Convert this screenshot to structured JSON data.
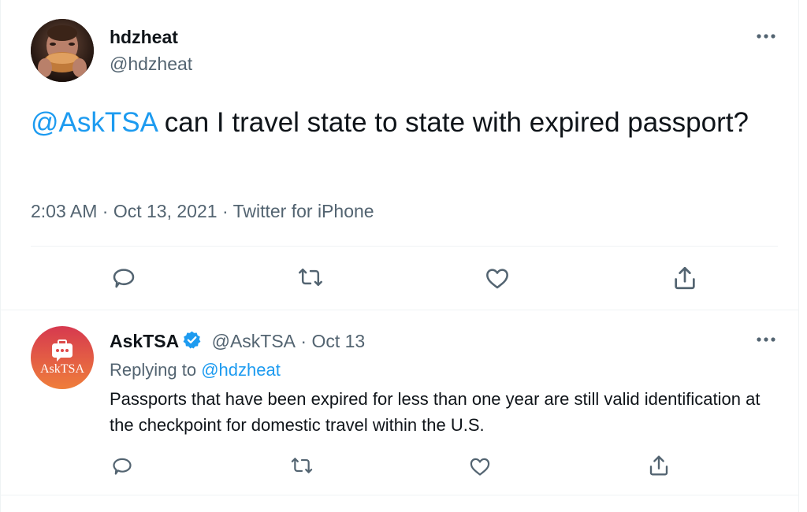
{
  "main_tweet": {
    "display_name": "hdzheat",
    "handle": "@hdzheat",
    "mention": "@AskTSA",
    "text": " can I travel state to state with expired passport?",
    "time": "2:03 AM",
    "date": "Oct 13, 2021",
    "source": "Twitter for iPhone",
    "separator": "·"
  },
  "reply": {
    "display_name": "AskTSA",
    "handle": "@AskTSA",
    "separator": "·",
    "date": "Oct 13",
    "replying_prefix": "Replying to ",
    "replying_to": "@hdzheat",
    "text": "Passports that have been expired for less than one year are still valid identification at the checkpoint for domestic travel within the U.S.",
    "avatar_logo_text": "AskTSA"
  },
  "icons": {
    "reply": "reply-icon",
    "retweet": "retweet-icon",
    "like": "heart-icon",
    "share": "share-icon",
    "more": "more-icon",
    "verified": "verified-badge-icon"
  },
  "colors": {
    "link": "#1d9bf0",
    "secondary_text": "#536471",
    "divider": "#eff3f4",
    "verified": "#1d9bf0"
  }
}
